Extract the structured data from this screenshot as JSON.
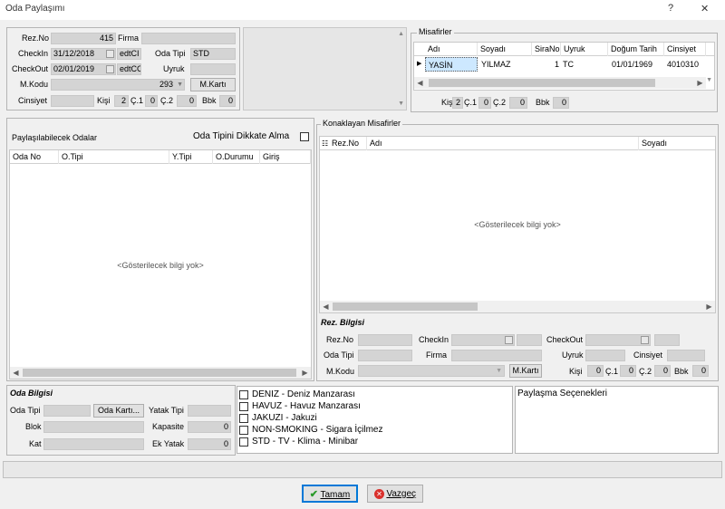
{
  "window": {
    "title": "Oda Paylaşımı",
    "help": "?",
    "close": "✕"
  },
  "res": {
    "rezno_label": "Rez.No",
    "rezno": "415",
    "firma_label": "Firma",
    "firma": "",
    "checkin_label": "CheckIn",
    "checkin": "31/12/2018",
    "checkin_edt": "edtCI",
    "checkout_label": "CheckOut",
    "checkout": "02/01/2019",
    "checkout_edt": "edtCC",
    "odatipi_label": "Oda Tipi",
    "odatipi": "STD",
    "uyruk_label": "Uyruk",
    "uyruk": "",
    "mkodu_label": "M.Kodu",
    "mkodu": "293",
    "mkarti_btn": "M.Kartı",
    "cinsiyet_label": "Cinsiyet",
    "cinsiyet": "",
    "kisi_label": "Kişi",
    "kisi": "2",
    "c1_label": "Ç.1",
    "c1": "0",
    "c2_label": "Ç.2",
    "c2": "0",
    "bbk_label": "Bbk",
    "bbk": "0"
  },
  "guests": {
    "title": "Misafirler",
    "columns": [
      "Adı",
      "Soyadı",
      "SiraNo",
      "Uyruk",
      "Doğum Tarih",
      "Cinsiyet"
    ],
    "rows": [
      {
        "adi": "YASİN",
        "soyadi": "YILMAZ",
        "sirano": "1",
        "uyruk": "TC",
        "dogum": "01/01/1969",
        "cinsiyet": "4010310"
      }
    ],
    "kisi_label": "Kişi",
    "kisi": "2",
    "c1_label": "Ç.1",
    "c1": "0",
    "c2_label": "Ç.2",
    "c2": "0",
    "bbk_label": "Bbk",
    "bbk": "0"
  },
  "shareable": {
    "title": "Paylaşılabilecek Odalar",
    "ignore_label": "Oda Tipini Dikkate Alma",
    "columns": [
      "Oda No",
      "O.Tipi",
      "Y.Tipi",
      "O.Durumu",
      "Giriş"
    ],
    "empty": "<Gösterilecek bilgi yok>"
  },
  "staying": {
    "title": "Konaklayan Misafirler",
    "columns": [
      "Rez.No",
      "Adı",
      "Soyadı"
    ],
    "empty": "<Gösterilecek bilgi yok>"
  },
  "rez_info": {
    "title": "Rez. Bilgisi",
    "rezno_label": "Rez.No",
    "checkin_label": "CheckIn",
    "checkout_label": "CheckOut",
    "odatipi_label": "Oda Tipi",
    "firma_label": "Firma",
    "uyruk_label": "Uyruk",
    "cinsiyet_label": "Cinsiyet",
    "mkodu_label": "M.Kodu",
    "mkarti_btn": "M.Kartı",
    "kisi_label": "Kişi",
    "kisi": "0",
    "c1_label": "Ç.1",
    "c1": "0",
    "c2_label": "Ç.2",
    "c2": "0",
    "bbk_label": "Bbk",
    "bbk": "0"
  },
  "room_info": {
    "title": "Oda Bilgisi",
    "odatipi_label": "Oda Tipi",
    "odakarti_btn": "Oda Kartı...",
    "yataktipi_label": "Yatak Tipi",
    "blok_label": "Blok",
    "kapasite_label": "Kapasite",
    "kapasite": "0",
    "kat_label": "Kat",
    "ekyatak_label": "Ek Yatak",
    "ekyatak": "0"
  },
  "features": [
    "DENIZ - Deniz Manzarası",
    "HAVUZ - Havuz Manzarası",
    "JAKUZI - Jakuzi",
    "NON-SMOKING - Sigara İçilmez",
    "STD - TV - Klima - Minibar"
  ],
  "share_options": {
    "title": "Paylaşma Seçenekleri"
  },
  "buttons": {
    "ok": "Tamam",
    "cancel": "Vazgeç"
  }
}
